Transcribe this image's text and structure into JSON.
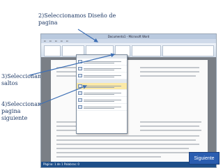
{
  "annotations": {
    "step_design": "2)Seleccionamos  Diseño de pagina",
    "step_breaks": "3)Seleccionamos saltos",
    "step_next_page": "4)Seleccionamos pagina siguiente"
  },
  "screenshot": {
    "window_title": "Documento1 - Microsoft Word",
    "status_text": "Página: 1 de 1   Palabras: 0"
  },
  "navigation": {
    "next_label": "Siguiente"
  },
  "colors": {
    "annotation_text": "#1f3a66",
    "arrow": "#3d6fb5",
    "button": "#2a5db0",
    "highlight": "#fbe9a6"
  }
}
